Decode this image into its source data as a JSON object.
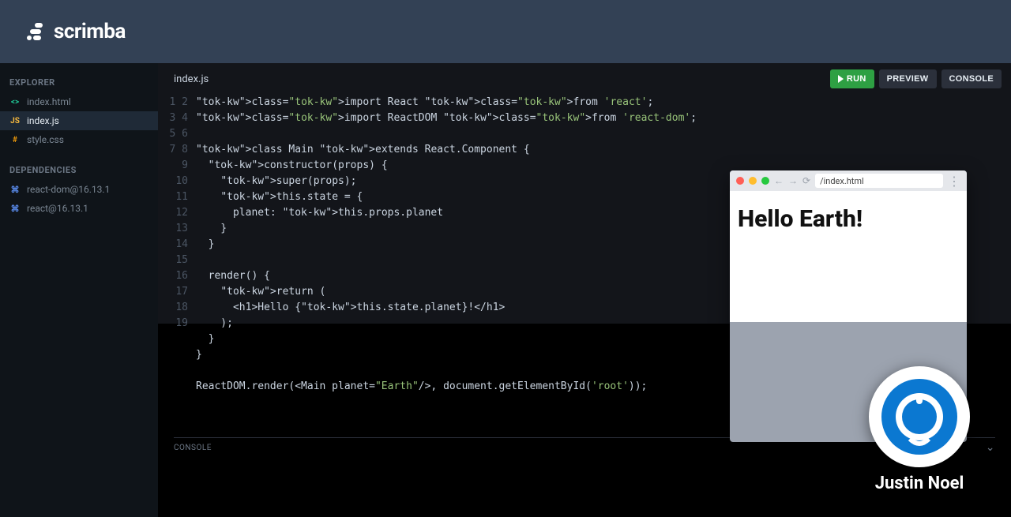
{
  "brand": {
    "name": "scrimba"
  },
  "sidebar": {
    "explorer_heading": "EXPLORER",
    "dependencies_heading": "DEPENDENCIES",
    "files": [
      {
        "label": "index.html",
        "icon": "html",
        "active": false
      },
      {
        "label": "index.js",
        "icon": "js",
        "active": true
      },
      {
        "label": "style.css",
        "icon": "css",
        "active": false
      }
    ],
    "deps": [
      {
        "label": "react-dom@16.13.1"
      },
      {
        "label": "react@16.13.1"
      }
    ]
  },
  "editor": {
    "tab": "index.js",
    "buttons": {
      "run": "RUN",
      "preview": "PREVIEW",
      "console": "CONSOLE"
    },
    "line_numbers": [
      "1",
      "2",
      "3",
      "4",
      "5",
      "6",
      "7",
      "8",
      "9",
      "10",
      "11",
      "12",
      "13",
      "14",
      "15",
      "16",
      "17",
      "18",
      "19"
    ],
    "code_plain": "import React from 'react';\nimport ReactDOM from 'react-dom';\n\nclass Main extends React.Component {\n  constructor(props) {\n    super(props);\n    this.state = {\n      planet: this.props.planet\n    }\n  }\n\n  render() {\n    return (\n      <h1>Hello {this.state.planet}!</h1>\n    );\n  }\n}\n\nReactDOM.render(<Main planet=\"Earth\"/>, document.getElementById('root'));"
  },
  "console": {
    "label": "CONSOLE"
  },
  "preview": {
    "url": "/index.html",
    "output": "Hello Earth!"
  },
  "presenter": {
    "name": "Justin Noel"
  }
}
